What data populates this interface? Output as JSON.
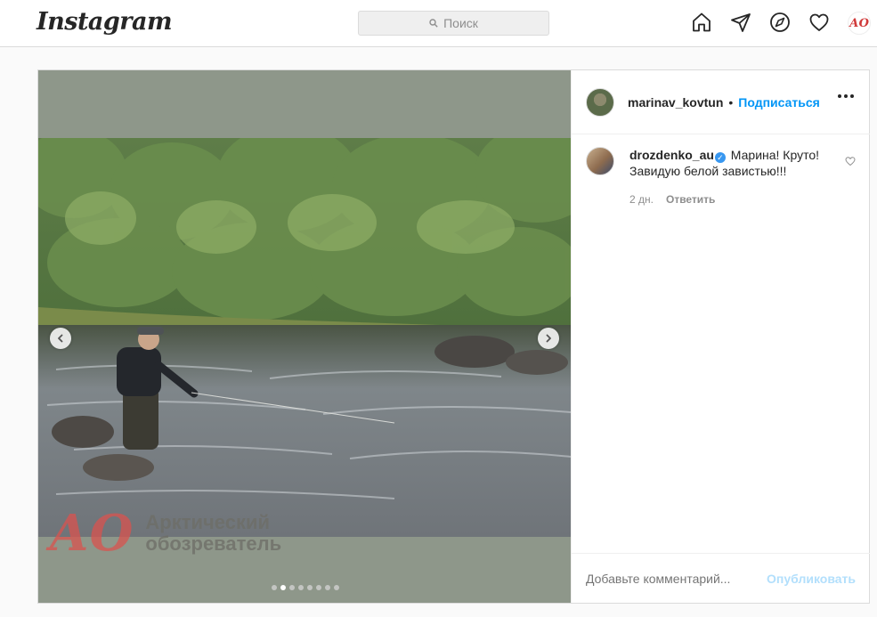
{
  "nav": {
    "logo": "Instagram",
    "search_placeholder": "Поиск",
    "icons": [
      "home-icon",
      "direct-icon",
      "explore-icon",
      "activity-heart-icon",
      "profile-avatar"
    ],
    "profile_initials": "АО"
  },
  "post": {
    "author": "marinav_kovtun",
    "separator": "•",
    "follow_label": "Подписаться",
    "more_icon": "more-options-icon",
    "watermark": {
      "logo": "АО",
      "line1": "Арктический",
      "line2": "обозреватель"
    },
    "carousel": {
      "total": 8,
      "active_index": 1
    },
    "comments": [
      {
        "user": "drozdenko_au",
        "verified": true,
        "text": "Марина! Круто! Завидую белой завистью!!!",
        "time": "2 дн.",
        "reply_label": "Ответить"
      }
    ],
    "add_comment_placeholder": "Добавьте комментарий...",
    "publish_label": "Опубликовать"
  },
  "colors": {
    "accent": "#0095f6",
    "publish_disabled": "#b2dffc",
    "watermark_red": "#d9534f"
  }
}
